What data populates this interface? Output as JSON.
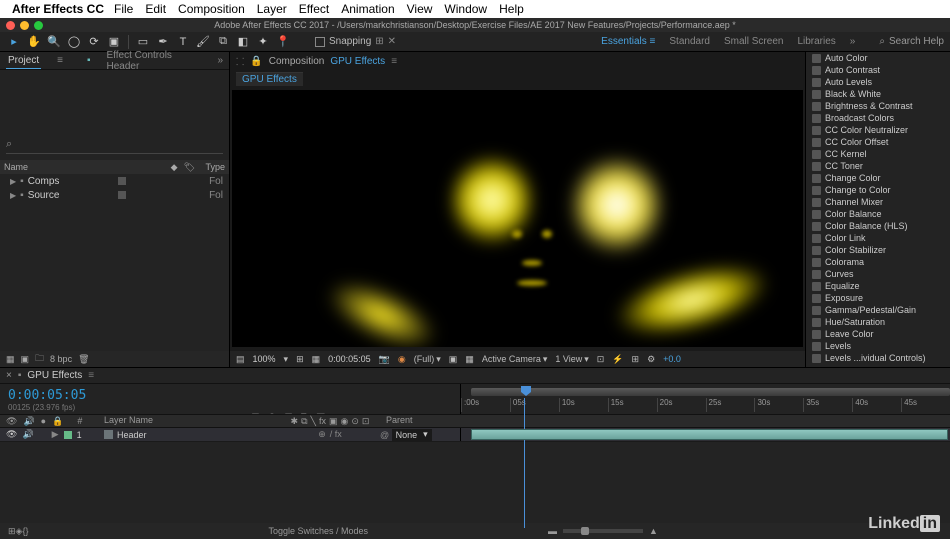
{
  "menubar": {
    "app_name": "After Effects CC",
    "items": [
      "File",
      "Edit",
      "Composition",
      "Layer",
      "Effect",
      "Animation",
      "View",
      "Window",
      "Help"
    ]
  },
  "window": {
    "title": "Adobe After Effects CC 2017 - /Users/markchristianson/Desktop/Exercise Files/AE 2017 New Features/Projects/Performance.aep *"
  },
  "toolbar": {
    "snapping_label": "Snapping",
    "workspaces": [
      "Essentials",
      "Standard",
      "Small Screen",
      "Libraries"
    ],
    "active_workspace": "Essentials",
    "search_placeholder": "Search Help"
  },
  "project_panel": {
    "tab_project": "Project",
    "tab_effect_controls": "Effect Controls Header",
    "columns": {
      "name": "Name",
      "type": "Type"
    },
    "rows": [
      {
        "name": "Comps",
        "type": "Fol"
      },
      {
        "name": "Source",
        "type": "Fol"
      }
    ],
    "bpc": "8 bpc"
  },
  "composition_panel": {
    "prefix": "Composition",
    "name": "GPU Effects",
    "subtab": "GPU Effects"
  },
  "viewer_footer": {
    "zoom": "100%",
    "timecode": "0:00:05:05",
    "resolution": "(Full)",
    "camera": "Active Camera",
    "views": "1 View",
    "exposure": "+0.0"
  },
  "effects_list": [
    "Auto Color",
    "Auto Contrast",
    "Auto Levels",
    "Black & White",
    "Brightness & Contrast",
    "Broadcast Colors",
    "CC Color Neutralizer",
    "CC Color Offset",
    "CC Kernel",
    "CC Toner",
    "Change Color",
    "Change to Color",
    "Channel Mixer",
    "Color Balance",
    "Color Balance (HLS)",
    "Color Link",
    "Color Stabilizer",
    "Colorama",
    "Curves",
    "Equalize",
    "Exposure",
    "Gamma/Pedestal/Gain",
    "Hue/Saturation",
    "Leave Color",
    "Levels",
    "Levels ...ividual Controls)"
  ],
  "timeline": {
    "comp_name": "GPU Effects",
    "timecode": "0:00:05:05",
    "frames_fps": "00125 (23.976 fps)",
    "columns": {
      "layer_name": "Layer Name",
      "parent": "Parent"
    },
    "ticks": [
      ":00s",
      "05s",
      "10s",
      "15s",
      "20s",
      "25s",
      "30s",
      "35s",
      "40s",
      "45s"
    ],
    "layer": {
      "index": "1",
      "name": "Header",
      "parent_value": "None",
      "fx": "/ fx"
    },
    "toggle_label": "Toggle Switches / Modes"
  },
  "branding": {
    "linked": "Linked",
    "in": "in"
  }
}
